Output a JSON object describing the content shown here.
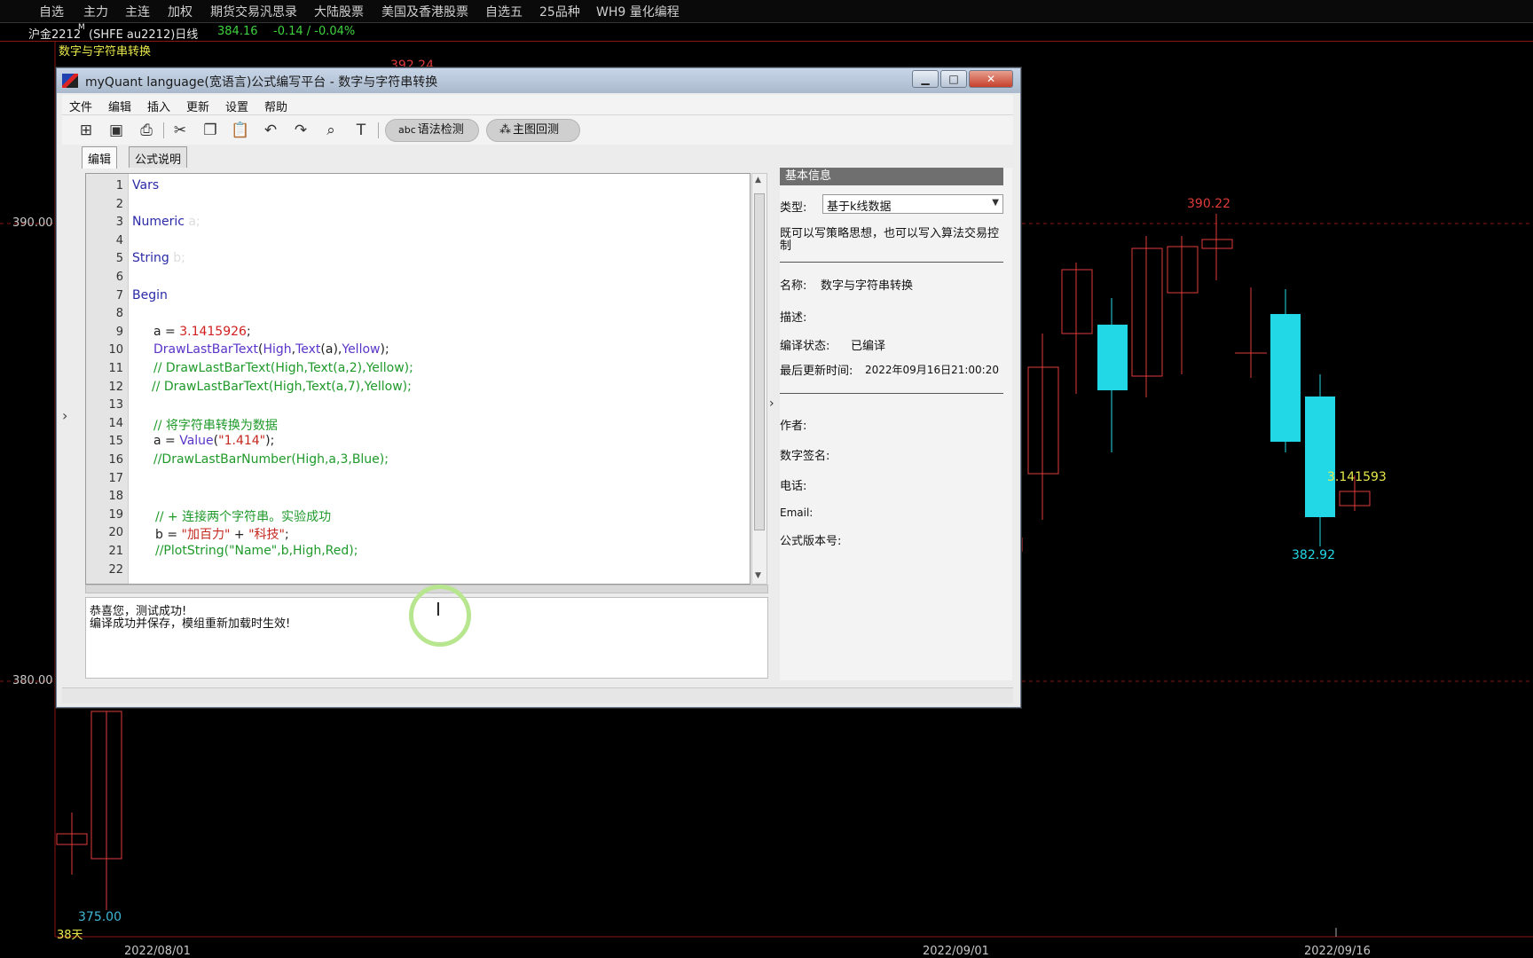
{
  "top_menu": [
    "自选",
    "主力",
    "主连",
    "加权",
    "期货交易汎思录",
    "大陆股票",
    "美国及香港股票",
    "自选五",
    "25品种",
    "WH9 量化编程"
  ],
  "quote": {
    "symbol": "沪金2212",
    "superscript": "M",
    "exchange": "(SHFE au2212)日线",
    "price": "384.16",
    "change": "-0.14 / -0.04%"
  },
  "indicator_name": "数字与字符串转换",
  "chart": {
    "price_axis": [
      "390.00",
      "380.00"
    ],
    "labels": {
      "top_partial": "392.24",
      "high": "390.22",
      "low": "382.92",
      "text_value": "3.141593",
      "left_low": "375.00",
      "days": "38天"
    },
    "dates": [
      "2022/08/01",
      "2022/09/01",
      "2022/09/16"
    ],
    "colors": {
      "up": "#e03a3a",
      "down": "#22d8e6",
      "grid": "#8b1515"
    }
  },
  "window": {
    "title": "myQuant language(宽语言)公式编写平台 - 数字与字符串转换",
    "controls": {
      "minimize": "▁",
      "maximize": "□",
      "close": "✕"
    },
    "menu": [
      "文件",
      "编辑",
      "插入",
      "更新",
      "设置",
      "帮助"
    ],
    "toolbar": {
      "syntax_check": "语法检测",
      "backtest": "主图回测",
      "syntax_icon_text": "abc"
    },
    "tabs": [
      "编辑",
      "公式说明"
    ],
    "code_lines": [
      "Vars",
      "",
      "Numeric a;",
      "",
      "String b;",
      "",
      "Begin",
      "",
      "a = 3.1415926;",
      "DrawLastBarText(High,Text(a),Yellow);",
      "// DrawLastBarText(High,Text(a,2),Yellow);",
      "// DrawLastBarText(High,Text(a,7),Yellow);",
      "",
      "// 将字符串转换为数据",
      "a = Value(\"1.414\");",
      "//DrawLastBarNumber(High,a,3,Blue);",
      "",
      "",
      "// + 连接两个字符串。实验成功",
      "b = \"加百力\" + \"科技\";",
      "//PlotString(\"Name\",b,High,Red);",
      ""
    ],
    "output": [
      "恭喜您，测试成功!",
      "编译成功并保存，模组重新加载时生效!"
    ],
    "info": {
      "header": "基本信息",
      "type_label": "类型:",
      "type_value": "基于k线数据",
      "description": "既可以写策略思想，也可以写入算法交易控制",
      "name_label": "名称:",
      "name_value": "数字与字符串转换",
      "desc_label": "描述:",
      "status_label": "编译状态:",
      "status_value": "已编译",
      "updated_label": "最后更新时间:",
      "updated_value": "2022年09月16日21:00:20",
      "author_label": "作者:",
      "signature_label": "数字签名:",
      "phone_label": "电话:",
      "email_label": "Email:",
      "version_label": "公式版本号:"
    }
  }
}
